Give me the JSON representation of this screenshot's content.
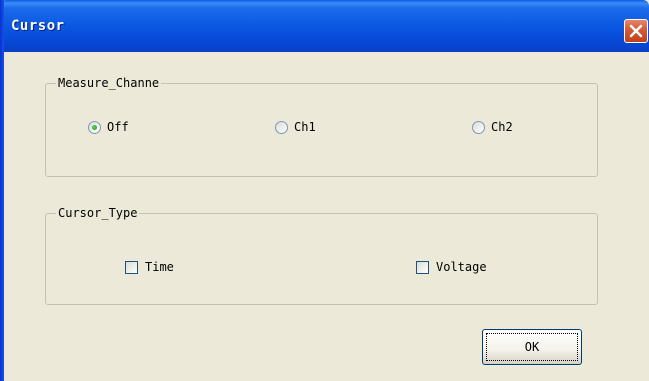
{
  "window": {
    "title": "Cursor",
    "close_icon": "close-icon"
  },
  "measure_channel": {
    "legend": "Measure_Channe",
    "options": [
      {
        "label": "Off",
        "checked": true
      },
      {
        "label": "Ch1",
        "checked": false
      },
      {
        "label": "Ch2",
        "checked": false
      }
    ]
  },
  "cursor_type": {
    "legend": "Cursor_Type",
    "options": [
      {
        "label": "Time",
        "checked": false
      },
      {
        "label": "Voltage",
        "checked": false
      }
    ]
  },
  "buttons": {
    "ok_label": "OK"
  },
  "colors": {
    "titlebar": "#0a55e0",
    "close_button": "#d35a37",
    "dialog_bg": "#ece9d8",
    "radio_dot": "#21a121"
  }
}
